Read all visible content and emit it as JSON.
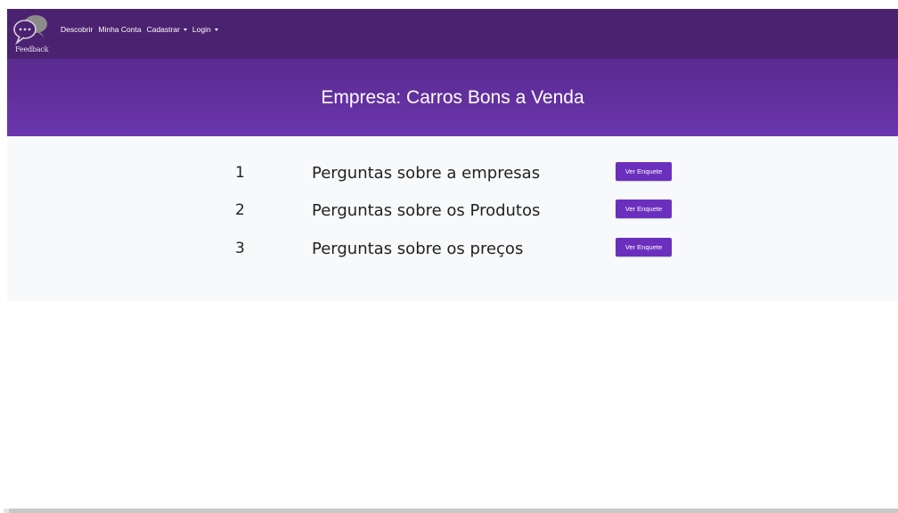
{
  "navbar": {
    "brand_text": "Feedback",
    "links": [
      {
        "label": "Descobrir",
        "dropdown": false
      },
      {
        "label": "Minha Conta",
        "dropdown": false
      },
      {
        "label": "Cadastrar",
        "dropdown": true
      },
      {
        "label": "Login",
        "dropdown": true
      }
    ],
    "background": "#4b2270"
  },
  "header": {
    "title": "Empresa: Carros Bons a Venda",
    "background": "#6a35ad"
  },
  "surveys": [
    {
      "number": "1",
      "title": "Perguntas sobre a empresas",
      "button_label": "Ver Enquete"
    },
    {
      "number": "2",
      "title": "Perguntas sobre os Produtos",
      "button_label": "Ver Enquete"
    },
    {
      "number": "3",
      "title": "Perguntas sobre os preços",
      "button_label": "Ver Enquete"
    }
  ],
  "button_color": "#6b2fbd"
}
